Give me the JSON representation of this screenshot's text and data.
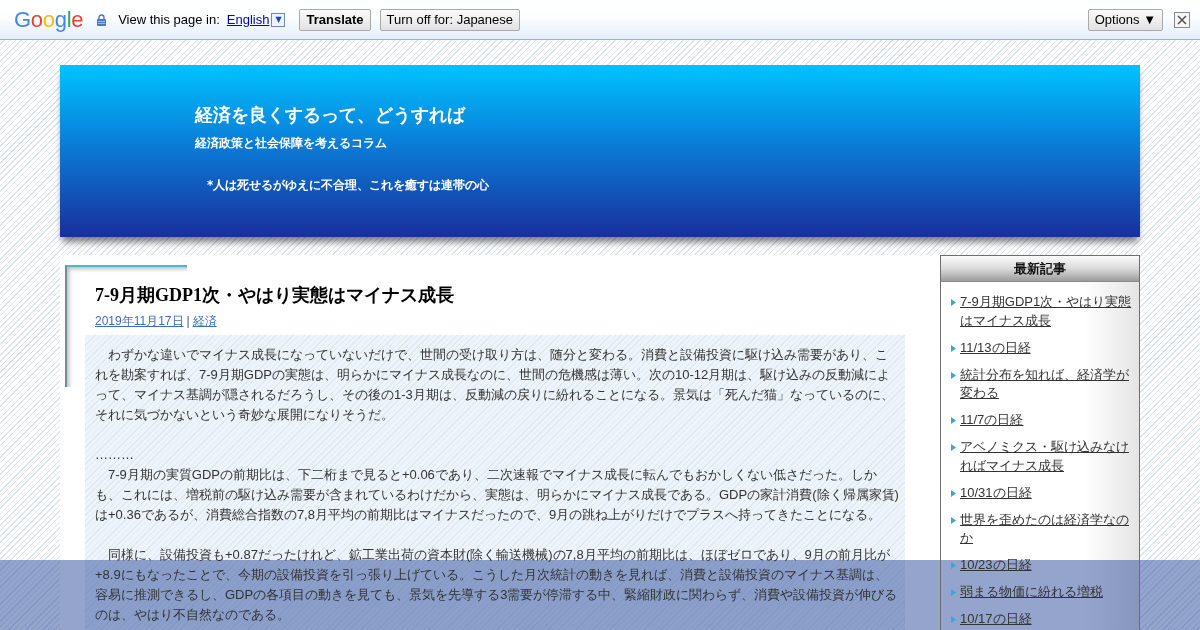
{
  "translate_bar": {
    "logo": "Google",
    "prompt": "View this page in:",
    "language": "English",
    "language_menu": "▼",
    "translate_button": "Translate",
    "turn_off_button": "Turn off for: Japanese",
    "options_button": "Options ▼"
  },
  "header": {
    "title": "経済を良くするって、どうすれば",
    "subtitle": "経済政策と社会保障を考えるコラム",
    "tagline": "*人は死せるがゆえに不合理、これを癒すは連帯の心"
  },
  "article": {
    "title": "7-9月期GDP1次・やはり実態はマイナス成長",
    "date": "2019年11月17日",
    "separator": "|",
    "category": "経済",
    "paragraphs": [
      {
        "kind": "text",
        "text": "わずかな違いでマイナス成長になっていないだけで、世間の受け取り方は、随分と変わる。消費と設備投資に駆け込み需要があり、これを勘案すれば、7-9月期GDPの実態は、明らかにマイナス成長なのに、世間の危機感は薄い。次の10-12月期は、駆け込みの反動減によって、マイナス基調が隠されるだろうし、その後の1-3月期は、反動減の戻りに紛れることになる。景気は「死んだ猫」なっているのに、それに気づかないという奇妙な展開になりそうだ。"
      },
      {
        "kind": "ellipsis",
        "text": "………"
      },
      {
        "kind": "text",
        "text": "7-9月期の実質GDPの前期比は、下二桁まで見ると+0.06であり、二次速報でマイナス成長に転んでもおかしくない低さだった。しかも、これには、増税前の駆け込み需要が含まれているわけだから、実態は、明らかにマイナス成長である。GDPの家計消費(除く帰属家賃)は+0.36であるが、消費総合指数の7,8月平均の前期比はマイナスだったので、9月の跳ね上がりだけでプラスへ持ってきたことになる。"
      },
      {
        "kind": "text",
        "text": "同様に、設備投資も+0.87だったけれど、鉱工業出荷の資本財(除く輸送機械)の7,8月平均の前期比は、ほぼゼロであり、9月の前月比が+8.9にもなったことで、今期の設備投資を引っ張り上げている。こうした月次統計の動きを見れば、消費と設備投資のマイナス基調は、容易に推測できるし、GDPの各項目の動きを見ても、景気を先導する3需要が停滞する中、緊縮財政に関わらず、消費や設備投資が伸びるのは、やはり不自然なのである。"
      }
    ]
  },
  "sidebar": {
    "heading": "最新記事",
    "items": [
      "7-9月期GDP1次・やはり実態はマイナス成長",
      "11/13の日経",
      "統計分布を知れば、経済学が変わる",
      "11/7の日経",
      "アベノミクス・駆け込みなければマイナス成長",
      "10/31の日経",
      "世界を歪めたのは経済学なのか",
      "10/23の日経",
      "弱まる物価に紛れる増税",
      "10/17の日経"
    ]
  }
}
